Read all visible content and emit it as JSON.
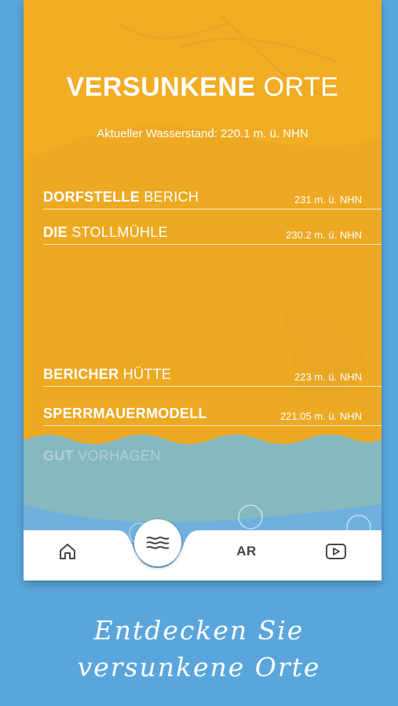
{
  "header": {
    "title_bold": "VERSUNKENE",
    "title_light": "ORTE",
    "water_level": "Aktueller Wasserstand: 220.1 m. ü. NHN"
  },
  "places": [
    {
      "bold": "DORFSTELLE",
      "light": "BERICH",
      "elevation": "231 m. ü. NHN"
    },
    {
      "bold": "DIE",
      "light": "STOLLMÜHLE",
      "elevation": "230.2 m. ü. NHN"
    },
    {
      "bold": "BERICHER",
      "light": "HÜTTE",
      "elevation": "223 m. ü. NHN"
    },
    {
      "bold": "SPERRMAUERMODELL",
      "light": "",
      "elevation": "221.05 m. ü. NHN"
    },
    {
      "bold": "GUT",
      "light": "VORHAGEN",
      "elevation": ""
    }
  ],
  "tabbar": {
    "home_icon": "home-icon",
    "waves_icon": "waves-icon",
    "ar_label": "AR",
    "video_icon": "play-icon"
  },
  "slogan": {
    "line1": "Entdecken Sie",
    "line2": "versunkene Orte"
  },
  "colors": {
    "background": "#5aa6dc",
    "panel": "#f2ad25",
    "water": "#7fb8c8"
  }
}
